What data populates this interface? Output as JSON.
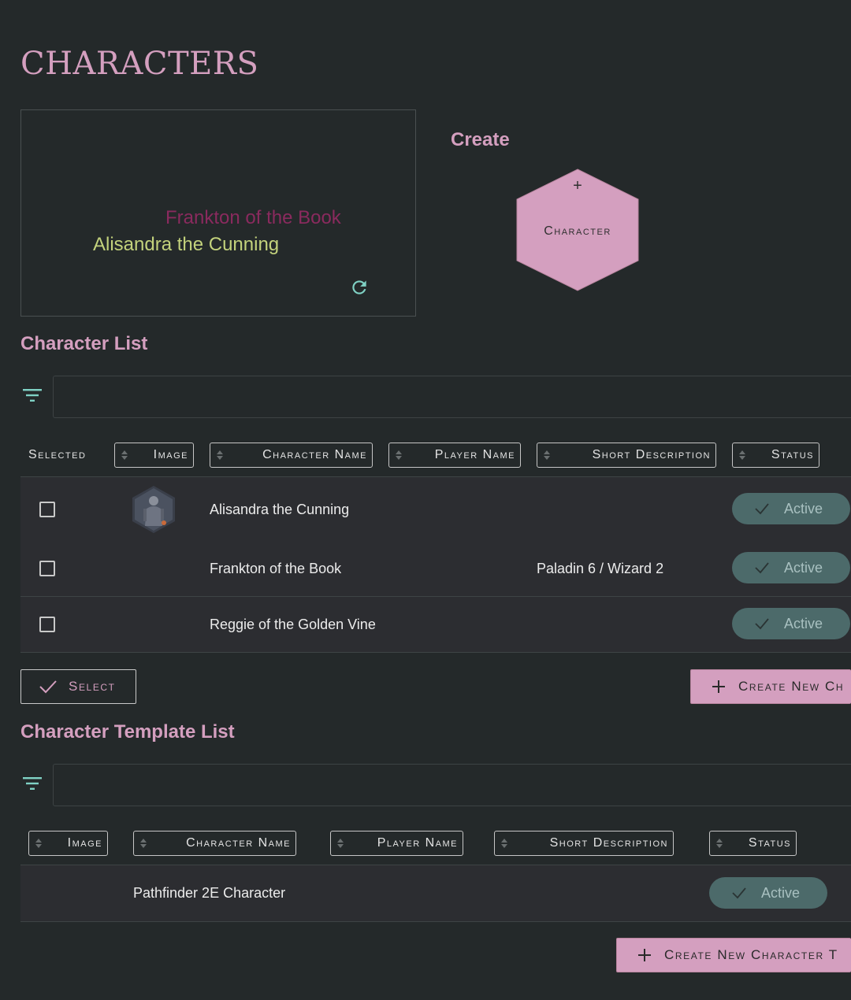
{
  "page": {
    "title": "Characters"
  },
  "cloud": {
    "words": [
      "Frankton of the Book",
      "Alisandra the Cunning"
    ],
    "colors": {
      "word1": "#8a2a5e",
      "word2": "#c3d27c",
      "refresh": "#7fd1c4"
    }
  },
  "create": {
    "heading": "Create",
    "hex_plus": "+",
    "hex_label": "Character"
  },
  "character_list": {
    "heading": "Character List",
    "filter_placeholder": "",
    "columns": {
      "selected": "Selected",
      "image": "Image",
      "name": "Character Name",
      "player": "Player Name",
      "description": "Short Description",
      "status": "Status"
    },
    "rows": [
      {
        "name": "Alisandra the Cunning",
        "player": "",
        "description": "",
        "status": "Active",
        "has_image": true
      },
      {
        "name": "Frankton of the Book",
        "player": "",
        "description": "Paladin 6 / Wizard 2",
        "status": "Active",
        "has_image": false
      },
      {
        "name": "Reggie of the Golden Vine",
        "player": "",
        "description": "",
        "status": "Active",
        "has_image": false
      }
    ],
    "select_button": "Select",
    "create_button": "Create New Ch"
  },
  "template_list": {
    "heading": "Character Template List",
    "filter_placeholder": "",
    "columns": {
      "image": "Image",
      "name": "Character Name",
      "player": "Player Name",
      "description": "Short Description",
      "status": "Status"
    },
    "rows": [
      {
        "name": "Pathfinder 2E Character",
        "status": "Active"
      }
    ],
    "create_button": "Create New Character T"
  },
  "colors": {
    "accent": "#d49fbf",
    "background": "#24292a",
    "row": "#2c2d31",
    "status_pill": "#4c6a6a",
    "filter_icon": "#7fd1c4"
  }
}
